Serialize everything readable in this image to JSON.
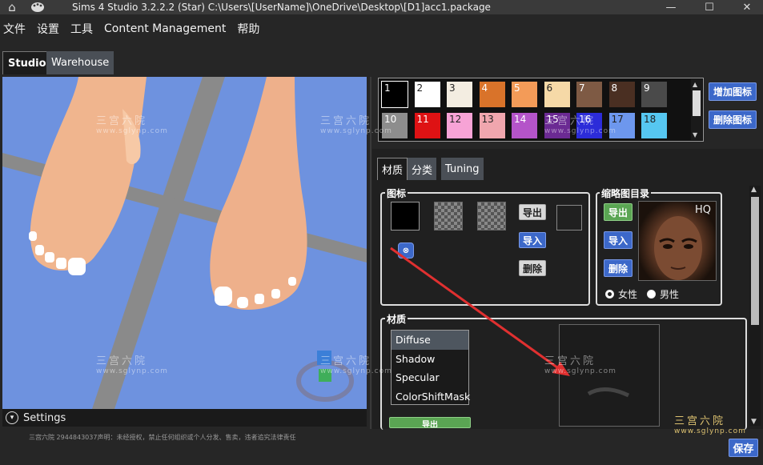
{
  "window": {
    "title": "Sims 4 Studio 3.2.2.2 (Star)  C:\\Users\\[UserName]\\OneDrive\\Desktop\\[D1]acc1.package",
    "home_icon": "⌂",
    "palette_icon": "🎨",
    "minimize": "—",
    "maximize": "☐",
    "close": "✕"
  },
  "menu": [
    "文件",
    "设置",
    "工具",
    "Content Management",
    "帮助"
  ],
  "tabs": {
    "studio": "Studio",
    "warehouse": "Warehouse"
  },
  "viewport": {
    "settings_label": "Settings",
    "settings_icon": "chevron-down"
  },
  "footer_note": "三宫六院 2944843037声明：未经授权，禁止任何组织或个人分发、售卖，违者追究法律责任",
  "swatches": [
    {
      "n": "1",
      "color": "#000000"
    },
    {
      "n": "2",
      "color": "#ffffff"
    },
    {
      "n": "3",
      "color": "#f3ede1"
    },
    {
      "n": "4",
      "color": "#d9732a"
    },
    {
      "n": "5",
      "color": "#f39b58"
    },
    {
      "n": "6",
      "color": "#f6d9a7"
    },
    {
      "n": "7",
      "color": "#7e5a44"
    },
    {
      "n": "8",
      "color": "#4a2f22"
    },
    {
      "n": "9",
      "color": "#4a4a4a"
    },
    {
      "n": "10",
      "color": "#8d8d8d"
    },
    {
      "n": "11",
      "color": "#de1214"
    },
    {
      "n": "12",
      "color": "#f7a3d6"
    },
    {
      "n": "13",
      "color": "#f0a6ae"
    },
    {
      "n": "14",
      "color": "#b454c9"
    },
    {
      "n": "15",
      "color": "#6b2a93"
    },
    {
      "n": "16",
      "color": "#2c2cd9"
    },
    {
      "n": "17",
      "color": "#6d97ee"
    },
    {
      "n": "18",
      "color": "#56c7f1"
    }
  ],
  "swatch_buttons": {
    "add": "增加图标",
    "remove": "删除图标"
  },
  "right_tabs": [
    "材质",
    "分类",
    "Tuning"
  ],
  "icon_group": {
    "title": "图标",
    "export": "导出",
    "import": "导入",
    "delete": "删除"
  },
  "thumb_group": {
    "title": "缩略图目录",
    "export": "导出",
    "import": "导入",
    "delete": "删除",
    "hq_label": "HQ",
    "female": "女性",
    "male": "男性"
  },
  "material_group": {
    "title": "材质",
    "items": [
      "Diffuse",
      "Shadow",
      "Specular",
      "ColorShiftMask"
    ],
    "selected": "Diffuse",
    "export": "导出"
  },
  "save": "保存",
  "watermark": {
    "brand": "三宫六院",
    "site": "www.sglynp.com"
  },
  "colors": {
    "viewport_bg": "#6e92df",
    "accent_blue": "#3c68c9",
    "accent_green": "#5aa553",
    "arrow_red": "#e03030"
  }
}
